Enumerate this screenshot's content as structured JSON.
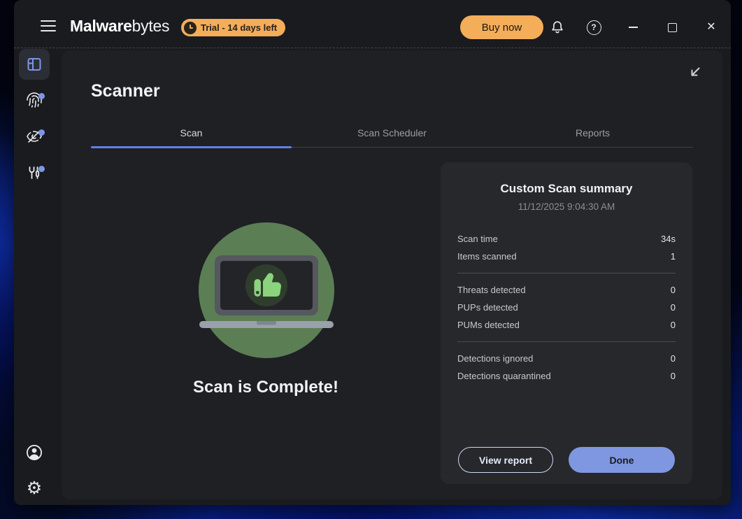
{
  "titlebar": {
    "logo": {
      "bold": "Malware",
      "light": "bytes"
    },
    "trial_badge": "Trial - 14 days left",
    "buy_now_label": "Buy now"
  },
  "window_controls": {
    "close_glyph": "✕"
  },
  "icons": {
    "settings_glyph": "⚙"
  },
  "main": {
    "title": "Scanner",
    "tabs": [
      {
        "label": "Scan",
        "active": true
      },
      {
        "label": "Scan Scheduler",
        "active": false
      },
      {
        "label": "Reports",
        "active": false
      }
    ],
    "scan_complete_text": "Scan is Complete!",
    "summary": {
      "title": "Custom Scan summary",
      "timestamp": "11/12/2025 9:04:30 AM",
      "groups": [
        {
          "rows": [
            {
              "label": "Scan time",
              "value": "34s"
            },
            {
              "label": "Items scanned",
              "value": "1"
            }
          ]
        },
        {
          "rows": [
            {
              "label": "Threats detected",
              "value": "0"
            },
            {
              "label": "PUPs detected",
              "value": "0"
            },
            {
              "label": "PUMs detected",
              "value": "0"
            }
          ]
        },
        {
          "rows": [
            {
              "label": "Detections ignored",
              "value": "0"
            },
            {
              "label": "Detections quarantined",
              "value": "0"
            }
          ]
        }
      ],
      "buttons": {
        "view_report": "View report",
        "done": "Done"
      }
    }
  },
  "colors": {
    "accent_orange": "#f4ad59",
    "accent_blue": "#7b96e8",
    "tab_underline": "#657ee4",
    "success_green": "#5c7e55",
    "thumb_green": "#8bd37c",
    "done_button": "#7e97e0"
  }
}
